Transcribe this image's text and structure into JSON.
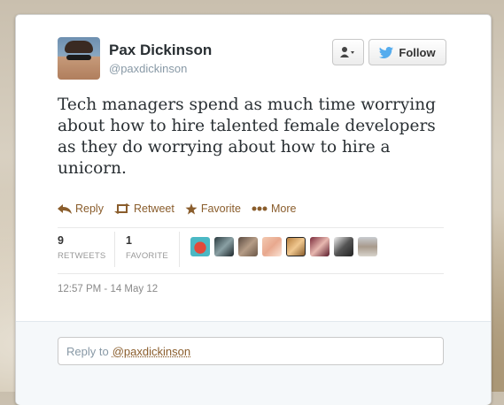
{
  "author": {
    "name": "Pax Dickinson",
    "handle": "@paxdickinson"
  },
  "buttons": {
    "follow_label": "Follow"
  },
  "tweet": {
    "text": "Tech managers spend as much time worrying about how to hire talented female developers as they do worrying about how to hire a unicorn."
  },
  "actions": {
    "reply": "Reply",
    "retweet": "Retweet",
    "favorite": "Favorite",
    "more": "More"
  },
  "stats": {
    "retweets_count": "9",
    "retweets_label": "RETWEETS",
    "favorites_count": "1",
    "favorites_label": "FAVORITE"
  },
  "timestamp": "12:57 PM - 14 May 12",
  "reply_box": {
    "prefix": "Reply to",
    "mention": "@paxdickinson"
  },
  "colors": {
    "link": "#8a5d2c",
    "twitter_blue": "#55acee"
  }
}
